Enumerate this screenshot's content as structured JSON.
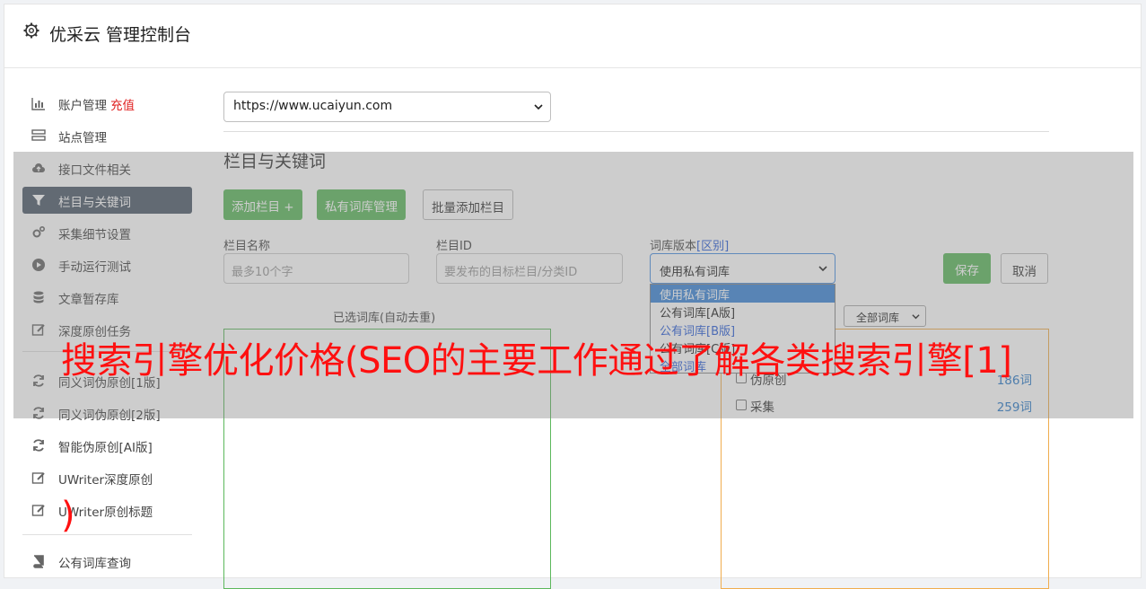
{
  "header": {
    "icon": "gear-icon",
    "title": "优采云 管理控制台"
  },
  "sidebar": {
    "items": [
      {
        "label": "账户管理",
        "badge": "充值",
        "icon": "bar-chart-icon"
      },
      {
        "label": "站点管理",
        "icon": "server-icon"
      },
      {
        "label": "接口文件相关",
        "icon": "cloud-upload-icon"
      },
      {
        "label": "栏目与关键词",
        "icon": "filter-icon",
        "active": true
      },
      {
        "label": "采集细节设置",
        "icon": "gears-icon"
      },
      {
        "label": "手动运行测试",
        "icon": "play-circle-icon"
      },
      {
        "label": "文章暂存库",
        "icon": "database-icon"
      },
      {
        "label": "深度原创任务",
        "icon": "edit-icon"
      },
      {
        "label": "同义词伪原创[1版]",
        "icon": "refresh-icon"
      },
      {
        "label": "同义词伪原创[2版]",
        "icon": "refresh-icon"
      },
      {
        "label": "智能伪原创[AI版]",
        "icon": "refresh-icon"
      },
      {
        "label": "UWriter深度原创",
        "icon": "edit-icon"
      },
      {
        "label": "UWriter原创标题",
        "icon": "edit-icon"
      },
      {
        "label": "公有词库查询",
        "icon": "book-icon"
      }
    ]
  },
  "site_select": {
    "value": "https://www.ucaiyun.com"
  },
  "section_title": "栏目与关键词",
  "buttons": {
    "add_column": "添加栏目 +",
    "private_lib": "私有词库管理",
    "batch_add": "批量添加栏目",
    "save": "保存",
    "cancel": "取消"
  },
  "form": {
    "column_name_label": "栏目名称",
    "column_name_placeholder": "最多10个字",
    "column_id_label": "栏目ID",
    "column_id_placeholder": "要发布的目标栏目/分类ID",
    "version_label": "词库版本",
    "version_link": "[区别]",
    "version_value": "使用私有词库"
  },
  "version_options": [
    "使用私有词库",
    "公有词库[A版]",
    "公有词库[B版]",
    "公有词库[C版]",
    "全部词库"
  ],
  "selected_panel_label": "已选词库(自动去重)",
  "filter_select": "全部词库",
  "word_libs": [
    {
      "name": "伪原创",
      "count": "186词"
    },
    {
      "name": "采集",
      "count": "259词"
    }
  ],
  "banner": {
    "line1": "搜索引擎优化价格(SEO的主要工作通过了解各类搜索引擎[1]",
    "line2": ")"
  },
  "colors": {
    "green": "#5cb85c",
    "sidebar_active": "#4e5a6a",
    "banner_red": "#ff1010",
    "link_blue": "#2a5ed8"
  }
}
